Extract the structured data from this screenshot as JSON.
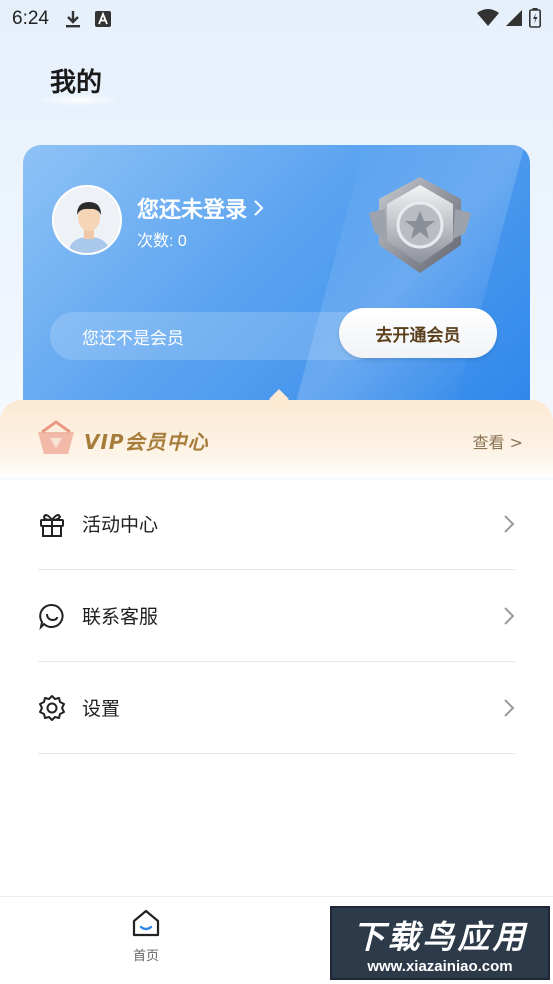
{
  "status_bar": {
    "time": "6:24"
  },
  "page": {
    "title": "我的"
  },
  "member_card": {
    "login_text": "您还未登录",
    "count_label": "次数:",
    "count_value": "0",
    "not_member_text": "您还不是会员",
    "open_member_button": "去开通会员"
  },
  "vip": {
    "title": "VIP会员中心",
    "more": "查看 >"
  },
  "menu": {
    "items": [
      {
        "label": "活动中心",
        "icon": "gift-icon"
      },
      {
        "label": "联系客服",
        "icon": "chat-icon"
      },
      {
        "label": "设置",
        "icon": "gear-icon"
      }
    ]
  },
  "bottom_nav": {
    "home_label": "首页"
  },
  "watermark": {
    "top": "下载鸟应用",
    "bottom": "www.xiazainiao.com"
  },
  "colors": {
    "card_start": "#8fc2f6",
    "card_end": "#2f86ea",
    "vip_gold": "#a67c3a",
    "button_text": "#5b3f1b"
  }
}
